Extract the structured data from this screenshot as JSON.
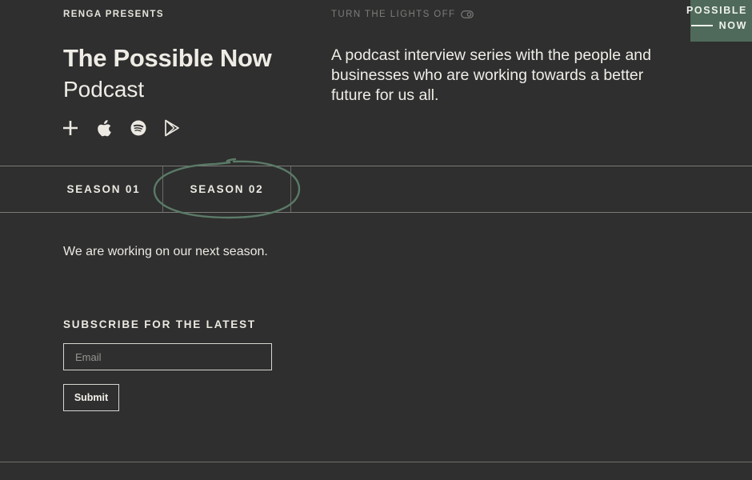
{
  "header": {
    "presents": "RENGA PRESENTS",
    "lights_toggle": "TURN THE LIGHTS OFF",
    "badge_line1": "POSSIBLE",
    "badge_line2": "NOW",
    "title": "The Possible Now",
    "subtitle": "Podcast",
    "description": "A podcast interview series with the people and businesses who are working towards a better future for us all."
  },
  "platform_icons": [
    "plus-icon",
    "apple-icon",
    "spotify-icon",
    "google-play-icon"
  ],
  "tabs": [
    {
      "label": "SEASON 01",
      "active": false
    },
    {
      "label": "SEASON 02",
      "active": true
    }
  ],
  "content": {
    "message": "We are working on our next season."
  },
  "subscribe": {
    "heading": "SUBSCRIBE FOR THE LATEST",
    "email_placeholder": "Email",
    "submit_label": "Submit"
  },
  "colors": {
    "background": "#2f2f2f",
    "text": "#ece9e2",
    "accent_green": "#4f6a5a",
    "circle_green": "#5b7a68"
  }
}
